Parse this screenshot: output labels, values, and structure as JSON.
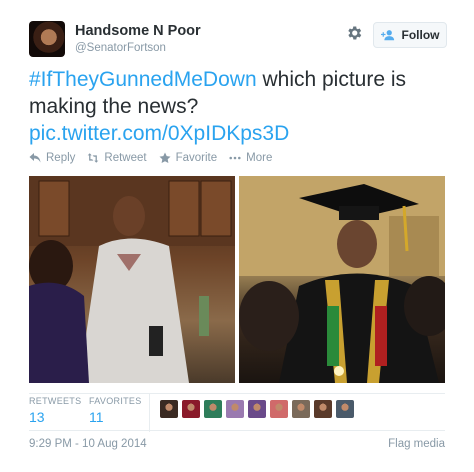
{
  "user": {
    "name": "Handsome N Poor",
    "handle": "@SenatorFortson"
  },
  "follow_button": {
    "label": "Follow"
  },
  "tweet": {
    "hashtag": "#IfTheyGunnedMeDown",
    "text": " which picture is making the news?",
    "link": "pic.twitter.com/0XpIDKps3D"
  },
  "actions": {
    "reply": "Reply",
    "retweet": "Retweet",
    "favorite": "Favorite",
    "more": "More"
  },
  "stats": {
    "retweets_label": "RETWEETS",
    "retweets_value": "13",
    "favorites_label": "FAVORITES",
    "favorites_value": "11"
  },
  "favoriter_avatar_colors": [
    "#3a2a22",
    "#8a1a2a",
    "#2e7d5a",
    "#9a7ab0",
    "#6a4a8a",
    "#d06a6a",
    "#7a6a5a",
    "#5a3a2a",
    "#4a5a6a"
  ],
  "timestamp": "9:29 PM - 10 Aug 2014",
  "flag_media": "Flag media"
}
